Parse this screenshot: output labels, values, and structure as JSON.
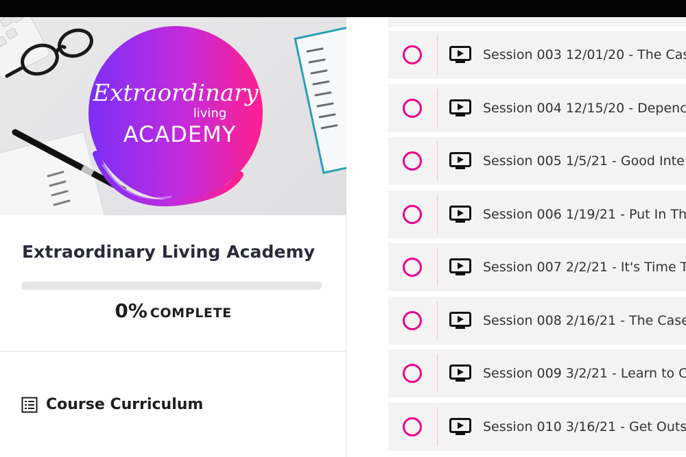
{
  "course": {
    "title": "Extraordinary Living Academy",
    "progress_fraction": 0.0,
    "progress_percent": "0%",
    "progress_label": "COMPLETE",
    "curriculum_label": "Course Curriculum",
    "logo": {
      "line1": "Extraordinary",
      "line2": "living",
      "line3": "ACADEMY",
      "gradient": [
        "#7b2ff7",
        "#c42bdc",
        "#ff1f8e"
      ]
    }
  },
  "colors": {
    "accent": "#ec008c",
    "topbar": "#050505",
    "lesson_bg": "#f3f3f3"
  },
  "lessons": [
    {
      "icon": "video-icon",
      "title": "Session 003 12/01/20 - The Cas"
    },
    {
      "icon": "video-icon",
      "title": "Session 004 12/15/20 - Depenc"
    },
    {
      "icon": "video-icon",
      "title": "Session 005 1/5/21 - Good Inte"
    },
    {
      "icon": "video-icon",
      "title": "Session 006 1/19/21 - Put In Th"
    },
    {
      "icon": "video-icon",
      "title": "Session 007 2/2/21 - It's Time T"
    },
    {
      "icon": "video-icon",
      "title": "Session 008 2/16/21 - The Case"
    },
    {
      "icon": "video-icon",
      "title": "Session 009 3/2/21 - Learn to C"
    },
    {
      "icon": "video-icon",
      "title": "Session 010 3/16/21 - Get Outs"
    }
  ]
}
